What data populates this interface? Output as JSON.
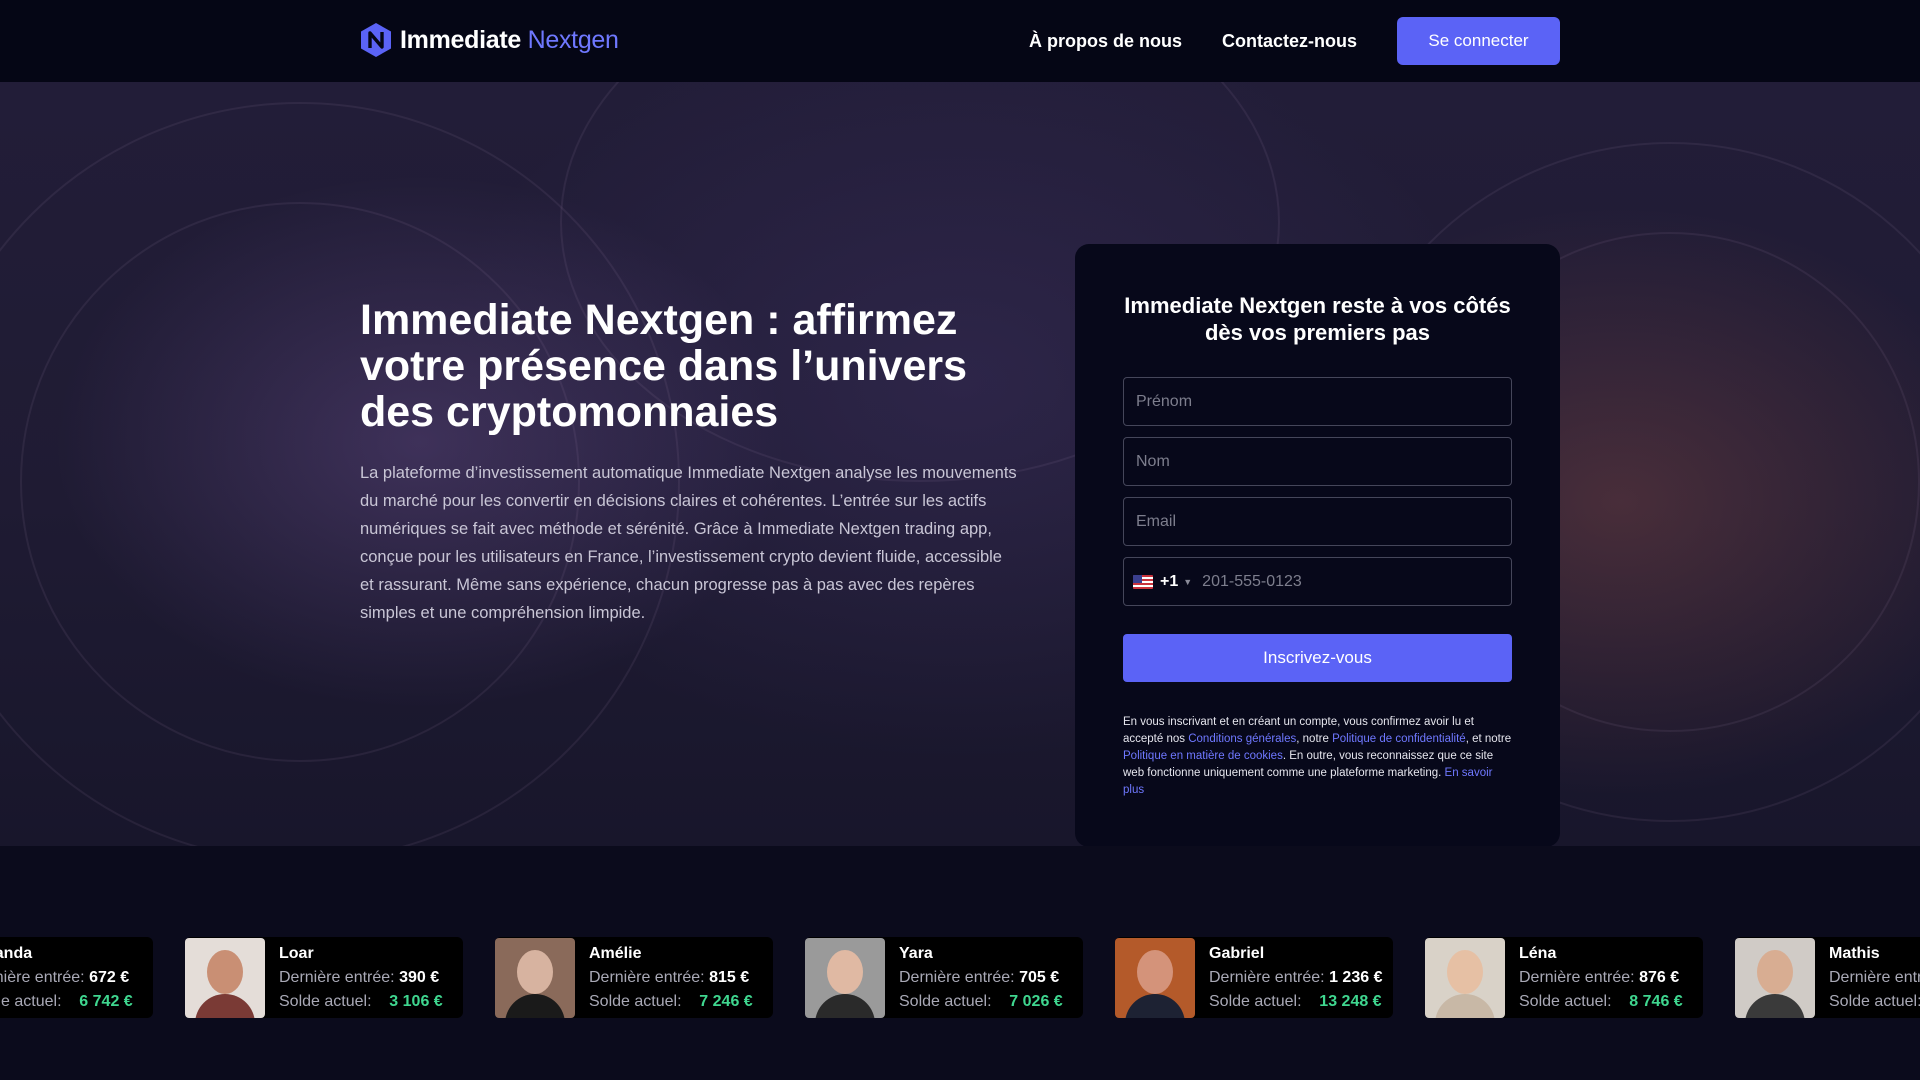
{
  "header": {
    "logo_main": "Immediate",
    "logo_accent": "Nextgen",
    "nav_about": "À propos de nous",
    "nav_contact": "Contactez-nous",
    "login_label": "Se connecter"
  },
  "hero": {
    "title": "Immediate Nextgen : affirmez votre présence dans l’univers des cryptomonnaies",
    "description": "La plateforme d’investissement automatique Immediate Nextgen analyse les mouvements du marché pour les convertir en décisions claires et cohérentes. L’entrée sur les actifs numériques se fait avec méthode et sérénité. Grâce à Immediate Nextgen trading app, conçue pour les utilisateurs en France, l’investissement crypto devient fluide, accessible et rassurant. Même sans expérience, chacun progresse pas à pas avec des repères simples et une compréhension limpide."
  },
  "form": {
    "title": "Immediate Nextgen reste à vos côtés dès vos premiers pas",
    "first_name_placeholder": "Prénom",
    "last_name_placeholder": "Nom",
    "email_placeholder": "Email",
    "phone_dial": "+1",
    "phone_placeholder": "201-555-0123",
    "submit_label": "Inscrivez-vous",
    "disclaimer_1": "En vous inscrivant et en créant un compte, vous confirmez avoir lu et accepté nos ",
    "link_terms": "Conditions générales",
    "disclaimer_2": ", notre ",
    "link_privacy": "Politique de confidentialité",
    "disclaimer_3": ", et notre ",
    "link_cookies": "Politique en matière de cookies",
    "disclaimer_4": ". En outre, vous reconnaissez que ce site web fonctionne uniquement comme une plateforme marketing. ",
    "link_more": "En savoir plus"
  },
  "testimonials": {
    "entry_label": "Dernière entrée:",
    "balance_label": "Solde actuel:",
    "items": [
      {
        "name": "Amanda",
        "entry": "672 €",
        "balance": "6 742 €",
        "skin": "#d9a88a",
        "hair": "#3a2a20",
        "bg": "#cfc6bb",
        "shirt": "#5b4a45"
      },
      {
        "name": "Loar",
        "entry": "390 €",
        "balance": "3 106 €",
        "skin": "#c98f74",
        "hair": "#2a1d17",
        "bg": "#e4ddd8",
        "shirt": "#7a3a35"
      },
      {
        "name": "Amélie",
        "entry": "815 €",
        "balance": "7 246 €",
        "skin": "#d7b3a0",
        "hair": "#d9d9d9",
        "bg": "#8a6a5a",
        "shirt": "#1a1a1a"
      },
      {
        "name": "Yara",
        "entry": "705 €",
        "balance": "7 026 €",
        "skin": "#e0b9a3",
        "hair": "#2e1f18",
        "bg": "#9a9a9a",
        "shirt": "#2a2a2a"
      },
      {
        "name": "Gabriel",
        "entry": "1 236 €",
        "balance": "13 248 €",
        "skin": "#d4937a",
        "hair": "#8a7a70",
        "bg": "#b45a2a",
        "shirt": "#1d2233"
      },
      {
        "name": "Léna",
        "entry": "876 €",
        "balance": "8 746 €",
        "skin": "#e6c0a4",
        "hair": "#d8b27a",
        "bg": "#d9d2c8",
        "shirt": "#c8b8a6"
      },
      {
        "name": "Mathis",
        "entry": "",
        "balance": "",
        "skin": "#d8ad92",
        "hair": "#2a1e18",
        "bg": "#d0cbc6",
        "shirt": "#3a3a3a"
      }
    ]
  },
  "colors": {
    "accent": "#5b63f6",
    "positive": "#3fd68f",
    "header_bg": "#050615",
    "card_bg": "#07081a"
  }
}
